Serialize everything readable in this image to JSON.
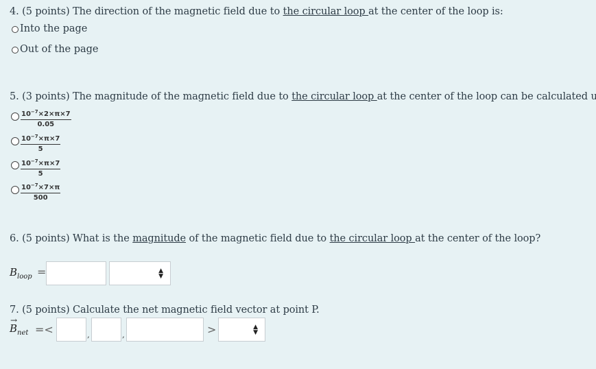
{
  "q4": {
    "prefix": "4. (5 points) The direction of the magnetic field due to ",
    "link": "the circular loop ",
    "suffix": "at the center of the loop is:",
    "options": [
      "Into the page",
      "Out of the page"
    ]
  },
  "q5": {
    "prefix": "5. (3 points) The magnitude of the magnetic field due to ",
    "link": "the circular loop ",
    "suffix": "at the center of the loop can be calculated using:",
    "options": [
      {
        "base": "10",
        "exp": "−7",
        "rest": "×2×π×7",
        "den": "0.05"
      },
      {
        "base": "10",
        "exp": "−7",
        "rest": "×π×7",
        "den": "5"
      },
      {
        "base": "10",
        "exp": "−7",
        "rest": "×π×7",
        "den": "5"
      },
      {
        "base": "10",
        "exp": "−7",
        "rest": "×7×π",
        "den": "500"
      }
    ]
  },
  "q6": {
    "prefix": "6. (5 points) What is the ",
    "link1": "magnitude",
    "middle": " of the magnetic field due to ",
    "link2": "the circular loop ",
    "suffix": " at the center of the loop?",
    "var_main": "B",
    "var_sub": "loop",
    "equals": "="
  },
  "q7": {
    "text": "7. (5 points) Calculate the net magnetic field vector at point P.",
    "var_main": "B",
    "var_sub": "net",
    "open": "=<",
    "close": ">",
    "comma": ","
  },
  "icons": {
    "select": "up-down-caret-icon"
  }
}
